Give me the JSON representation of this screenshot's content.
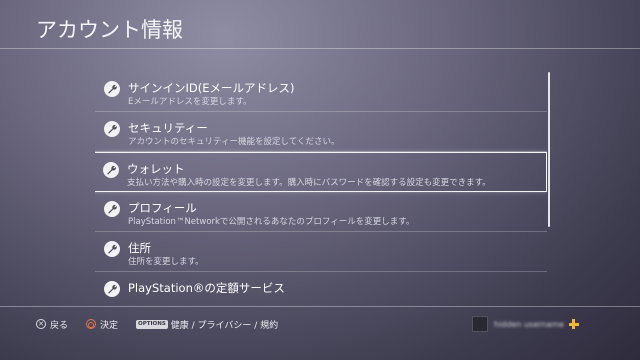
{
  "header": {
    "title": "アカウント情報"
  },
  "menu": {
    "items": [
      {
        "label": "サインインID(Eメールアドレス)",
        "description": "Eメールアドレスを変更します。",
        "icon": "wrench-icon"
      },
      {
        "label": "セキュリティー",
        "description": "アカウントのセキュリティー機能を設定してください。",
        "icon": "wrench-icon"
      },
      {
        "label": "ウォレット",
        "description": "支払い方法や購入時の設定を変更します。購入時にパスワードを確認する設定も変更できます。",
        "icon": "wrench-icon"
      },
      {
        "label": "プロフィール",
        "description": "PlayStation™Networkで公開されるあなたのプロフィールを変更します。",
        "icon": "wrench-icon"
      },
      {
        "label": "住所",
        "description": "住所を変更します。",
        "icon": "wrench-icon"
      },
      {
        "label": "PlayStation®の定額サービス",
        "description": "",
        "icon": "wrench-icon"
      }
    ],
    "selected_index": 2
  },
  "footer": {
    "back_label": "戻る",
    "confirm_label": "決定",
    "options_badge": "OPTIONS",
    "options_label": "健康 / プライバシー / 規約"
  },
  "user": {
    "name": "hidden username",
    "plus_icon": "plus-icon",
    "plus_color": "#f1b53a"
  },
  "colors": {
    "accent_circle": "#e8744a",
    "selection_border": "#f3f3f3"
  }
}
